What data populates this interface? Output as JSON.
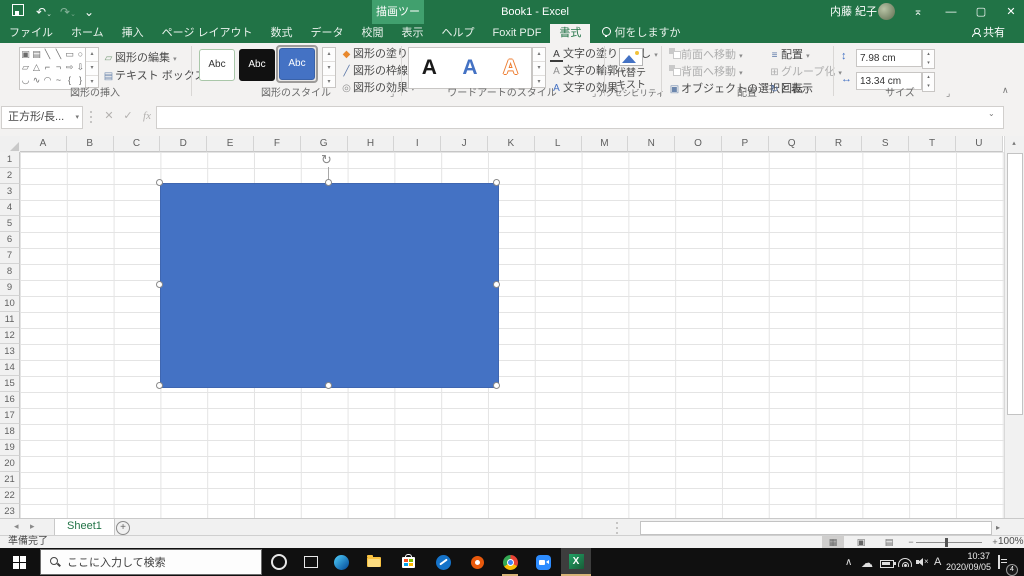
{
  "icons": {
    "undo": "↶",
    "redo": "↷",
    "qat_more": "⌄",
    "ribbon_opts": "⌅",
    "minimize": "—",
    "maximize": "▢",
    "close": "✕",
    "dropdown": "▾",
    "up": "▴",
    "down": "▾",
    "more": "▾",
    "launcher": "⌟",
    "collapse": "∧",
    "cancel": "✕",
    "enter": "✓",
    "fx": "fx",
    "namebox_drop": "▾",
    "formula_expand": "⌄",
    "nav_left": "◂",
    "nav_right": "▸",
    "add_sheet": "+",
    "scroll_up": "▴",
    "scroll_left": "◂",
    "scroll_right": "▸",
    "view_normal": "▦",
    "view_layout": "▣",
    "view_break": "▤",
    "zoom_minus": "−",
    "zoom_plus": "+",
    "rotate": "↻",
    "height_icon": "↕",
    "width_icon": "↔",
    "edit_shape": "▱",
    "text_box": "▤",
    "fill_icon": "◆",
    "outline_icon": "╱",
    "effect_icon": "◎",
    "select_pane": "▣",
    "align_icon": "≡",
    "group_icon": "⊞",
    "wordart_fill": "A",
    "wordart_outline": "A",
    "wordart_effect": "A",
    "tray_chevron": "∧",
    "cloud": "☁",
    "ime": "A"
  },
  "titlebar": {
    "contextual": "描画ツール",
    "title": "Book1 - Excel",
    "user": "内藤 紀子"
  },
  "tabrow": {
    "tabs": [
      {
        "label": "ファイル"
      },
      {
        "label": "ホーム"
      },
      {
        "label": "挿入"
      },
      {
        "label": "ページ レイアウト"
      },
      {
        "label": "数式"
      },
      {
        "label": "データ"
      },
      {
        "label": "校閲"
      },
      {
        "label": "表示"
      },
      {
        "label": "ヘルプ"
      },
      {
        "label": "Foxit PDF"
      },
      {
        "label": "書式",
        "active": true
      }
    ],
    "tellme": "何をしますか",
    "share": "共有"
  },
  "ribbon": {
    "insert_shapes": {
      "label": "図形の挿入",
      "gallery": [
        [
          "▣",
          "▤",
          "╲",
          "╲",
          "▭",
          "○"
        ],
        [
          "▱",
          "△",
          "⌐",
          "¬",
          "⇨",
          "⇩"
        ],
        [
          "◡",
          "∿",
          "◠",
          "~",
          "{",
          "}"
        ]
      ],
      "edit_shape": "図形の編集",
      "text_box": "テキスト ボックス"
    },
    "shape_styles": {
      "label": "図形のスタイル",
      "chip_text": "Abc",
      "fill": "図形の塗りつぶし",
      "outline": "図形の枠線",
      "effects": "図形の効果",
      "selected_fill": "#4472C4"
    },
    "wordart": {
      "label": "ワードアートのスタイル",
      "letters": [
        "A",
        "A",
        "A"
      ],
      "text_fill": "文字の塗りつぶし",
      "text_outline": "文字の輪郭",
      "text_effects": "文字の効果"
    },
    "accessibility": {
      "label": "アクセシビリティ",
      "alt_text_line1": "代替テ",
      "alt_text_line2": "キスト"
    },
    "arrange": {
      "label": "配置",
      "bring_forward": "前面へ移動",
      "send_backward": "背面へ移動",
      "selection_pane": "オブジェクトの選択と表示",
      "align": "配置",
      "group": "グループ化",
      "rotate": "回転"
    },
    "size": {
      "label": "サイズ",
      "height": "7.98 cm",
      "width": "13.34 cm"
    }
  },
  "formula": {
    "name_box": "正方形/長..."
  },
  "sheet": {
    "columns": [
      "A",
      "B",
      "C",
      "D",
      "E",
      "F",
      "G",
      "H",
      "I",
      "J",
      "K",
      "L",
      "M",
      "N",
      "O",
      "P",
      "Q",
      "R",
      "S",
      "T",
      "U"
    ],
    "rows": [
      1,
      2,
      3,
      4,
      5,
      6,
      7,
      8,
      9,
      10,
      11,
      12,
      13,
      14,
      15,
      16,
      17,
      18,
      19,
      20,
      21,
      22,
      23
    ]
  },
  "shape": {
    "fill": "#4472C4"
  },
  "sheet_tabs": {
    "active": "Sheet1"
  },
  "status": {
    "ready": "準備完了",
    "zoom": "100%"
  },
  "taskbar": {
    "search_placeholder": "ここに入力して検索",
    "time": "10:37",
    "date": "2020/09/05",
    "badge": "4"
  }
}
